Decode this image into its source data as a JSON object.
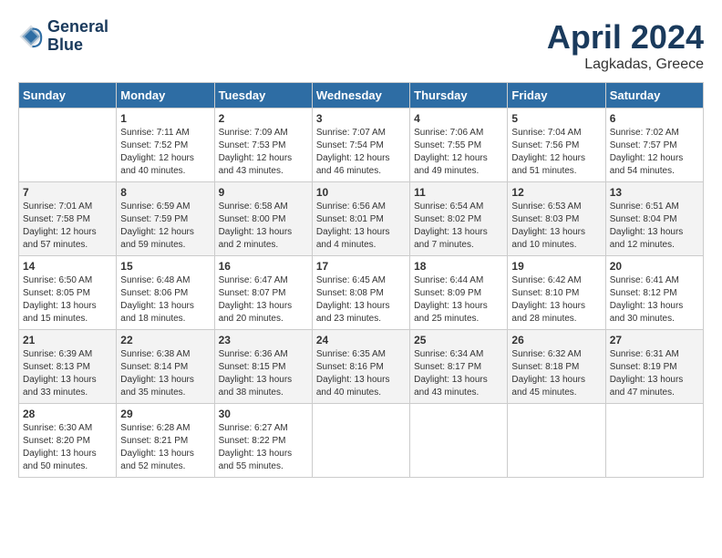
{
  "header": {
    "logo_line1": "General",
    "logo_line2": "Blue",
    "month": "April 2024",
    "location": "Lagkadas, Greece"
  },
  "columns": [
    "Sunday",
    "Monday",
    "Tuesday",
    "Wednesday",
    "Thursday",
    "Friday",
    "Saturday"
  ],
  "weeks": [
    [
      {
        "day": "",
        "info": ""
      },
      {
        "day": "1",
        "info": "Sunrise: 7:11 AM\nSunset: 7:52 PM\nDaylight: 12 hours\nand 40 minutes."
      },
      {
        "day": "2",
        "info": "Sunrise: 7:09 AM\nSunset: 7:53 PM\nDaylight: 12 hours\nand 43 minutes."
      },
      {
        "day": "3",
        "info": "Sunrise: 7:07 AM\nSunset: 7:54 PM\nDaylight: 12 hours\nand 46 minutes."
      },
      {
        "day": "4",
        "info": "Sunrise: 7:06 AM\nSunset: 7:55 PM\nDaylight: 12 hours\nand 49 minutes."
      },
      {
        "day": "5",
        "info": "Sunrise: 7:04 AM\nSunset: 7:56 PM\nDaylight: 12 hours\nand 51 minutes."
      },
      {
        "day": "6",
        "info": "Sunrise: 7:02 AM\nSunset: 7:57 PM\nDaylight: 12 hours\nand 54 minutes."
      }
    ],
    [
      {
        "day": "7",
        "info": "Sunrise: 7:01 AM\nSunset: 7:58 PM\nDaylight: 12 hours\nand 57 minutes."
      },
      {
        "day": "8",
        "info": "Sunrise: 6:59 AM\nSunset: 7:59 PM\nDaylight: 12 hours\nand 59 minutes."
      },
      {
        "day": "9",
        "info": "Sunrise: 6:58 AM\nSunset: 8:00 PM\nDaylight: 13 hours\nand 2 minutes."
      },
      {
        "day": "10",
        "info": "Sunrise: 6:56 AM\nSunset: 8:01 PM\nDaylight: 13 hours\nand 4 minutes."
      },
      {
        "day": "11",
        "info": "Sunrise: 6:54 AM\nSunset: 8:02 PM\nDaylight: 13 hours\nand 7 minutes."
      },
      {
        "day": "12",
        "info": "Sunrise: 6:53 AM\nSunset: 8:03 PM\nDaylight: 13 hours\nand 10 minutes."
      },
      {
        "day": "13",
        "info": "Sunrise: 6:51 AM\nSunset: 8:04 PM\nDaylight: 13 hours\nand 12 minutes."
      }
    ],
    [
      {
        "day": "14",
        "info": "Sunrise: 6:50 AM\nSunset: 8:05 PM\nDaylight: 13 hours\nand 15 minutes."
      },
      {
        "day": "15",
        "info": "Sunrise: 6:48 AM\nSunset: 8:06 PM\nDaylight: 13 hours\nand 18 minutes."
      },
      {
        "day": "16",
        "info": "Sunrise: 6:47 AM\nSunset: 8:07 PM\nDaylight: 13 hours\nand 20 minutes."
      },
      {
        "day": "17",
        "info": "Sunrise: 6:45 AM\nSunset: 8:08 PM\nDaylight: 13 hours\nand 23 minutes."
      },
      {
        "day": "18",
        "info": "Sunrise: 6:44 AM\nSunset: 8:09 PM\nDaylight: 13 hours\nand 25 minutes."
      },
      {
        "day": "19",
        "info": "Sunrise: 6:42 AM\nSunset: 8:10 PM\nDaylight: 13 hours\nand 28 minutes."
      },
      {
        "day": "20",
        "info": "Sunrise: 6:41 AM\nSunset: 8:12 PM\nDaylight: 13 hours\nand 30 minutes."
      }
    ],
    [
      {
        "day": "21",
        "info": "Sunrise: 6:39 AM\nSunset: 8:13 PM\nDaylight: 13 hours\nand 33 minutes."
      },
      {
        "day": "22",
        "info": "Sunrise: 6:38 AM\nSunset: 8:14 PM\nDaylight: 13 hours\nand 35 minutes."
      },
      {
        "day": "23",
        "info": "Sunrise: 6:36 AM\nSunset: 8:15 PM\nDaylight: 13 hours\nand 38 minutes."
      },
      {
        "day": "24",
        "info": "Sunrise: 6:35 AM\nSunset: 8:16 PM\nDaylight: 13 hours\nand 40 minutes."
      },
      {
        "day": "25",
        "info": "Sunrise: 6:34 AM\nSunset: 8:17 PM\nDaylight: 13 hours\nand 43 minutes."
      },
      {
        "day": "26",
        "info": "Sunrise: 6:32 AM\nSunset: 8:18 PM\nDaylight: 13 hours\nand 45 minutes."
      },
      {
        "day": "27",
        "info": "Sunrise: 6:31 AM\nSunset: 8:19 PM\nDaylight: 13 hours\nand 47 minutes."
      }
    ],
    [
      {
        "day": "28",
        "info": "Sunrise: 6:30 AM\nSunset: 8:20 PM\nDaylight: 13 hours\nand 50 minutes."
      },
      {
        "day": "29",
        "info": "Sunrise: 6:28 AM\nSunset: 8:21 PM\nDaylight: 13 hours\nand 52 minutes."
      },
      {
        "day": "30",
        "info": "Sunrise: 6:27 AM\nSunset: 8:22 PM\nDaylight: 13 hours\nand 55 minutes."
      },
      {
        "day": "",
        "info": ""
      },
      {
        "day": "",
        "info": ""
      },
      {
        "day": "",
        "info": ""
      },
      {
        "day": "",
        "info": ""
      }
    ]
  ]
}
